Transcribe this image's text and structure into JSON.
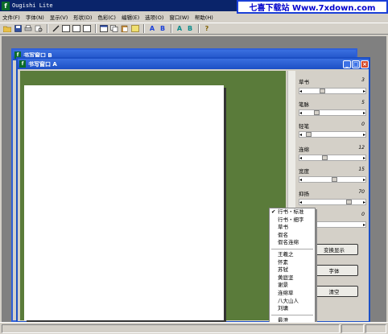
{
  "app": {
    "title": "Ougishi Lite",
    "watermark": "七喜下载站 Www.7xdown.com"
  },
  "menu": [
    "文件(F)",
    "字体(N)",
    "显示(V)",
    "形状(D)",
    "色彩(C)",
    "编辑(E)",
    "选项(O)",
    "窗口(W)",
    "帮助(H)"
  ],
  "toolbar": {
    "groups": [
      [
        "folder-open-icon",
        "save-icon",
        "print-icon",
        "print-preview-icon"
      ],
      [
        "pen-icon",
        "layout-1-icon",
        "layout-2-icon",
        "layout-3-icon"
      ],
      [
        "window-cascade-icon",
        "copy-icon",
        "paste-icon",
        "image-icon"
      ],
      [
        "font-a-blue-icon",
        "font-b-blue-icon"
      ],
      [
        "font-a-teal-icon",
        "font-b-teal-icon"
      ],
      [
        "help-icon"
      ]
    ],
    "text_buttons": {
      "A1": "A",
      "B1": "B",
      "A2": "A",
      "B2": "B",
      "help": "?"
    }
  },
  "windows": {
    "b": {
      "title": "书写窗口 B"
    },
    "a": {
      "title": "书写窗口 A"
    }
  },
  "panel": {
    "rows": [
      {
        "label": "草书",
        "value": "3",
        "level": 0.3
      },
      {
        "label": "笔脉",
        "value": "5",
        "level": 0.2
      },
      {
        "label": "轻笔",
        "value": "0",
        "level": 0.0
      },
      {
        "label": "连绵",
        "value": "12",
        "level": 0.3
      },
      {
        "label": "宽度",
        "value": "15",
        "level": 0.5
      },
      {
        "label": "抑扬",
        "value": "70",
        "level": 0.7
      },
      {
        "label": "",
        "value": "0",
        "level": 0.0
      }
    ],
    "buttons": {
      "convert": "变换显示",
      "font": "字体",
      "clear": "清空"
    }
  },
  "context_menu": {
    "group1": [
      {
        "label": "行书・标准",
        "checked": true
      },
      {
        "label": "行书・细字",
        "checked": false
      },
      {
        "label": "草书",
        "checked": false
      },
      {
        "label": "假名",
        "checked": false
      },
      {
        "label": "假名连绵",
        "checked": false
      }
    ],
    "group2": [
      "王羲之",
      "怀素",
      "苏轼",
      "黄庭坚",
      "谢景",
      "连绵草",
      "八大山人",
      "刘墉"
    ],
    "group3": [
      "最澄"
    ]
  }
}
